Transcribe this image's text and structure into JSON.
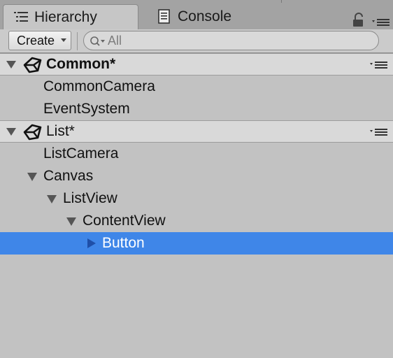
{
  "tabs": {
    "hierarchy": "Hierarchy",
    "console": "Console"
  },
  "toolbar": {
    "create_label": "Create",
    "search_placeholder": "All"
  },
  "scenes": [
    {
      "name": "Common*",
      "items": [
        "CommonCamera",
        "EventSystem"
      ]
    },
    {
      "name": "List*",
      "items": [
        "ListCamera",
        "Canvas",
        "ListView",
        "ContentView",
        "Button"
      ]
    }
  ],
  "selected_item": "Button",
  "colors": {
    "selection": "#3f86e8",
    "panel": "#c2c2c2",
    "scene_header": "#d9d9d9"
  }
}
